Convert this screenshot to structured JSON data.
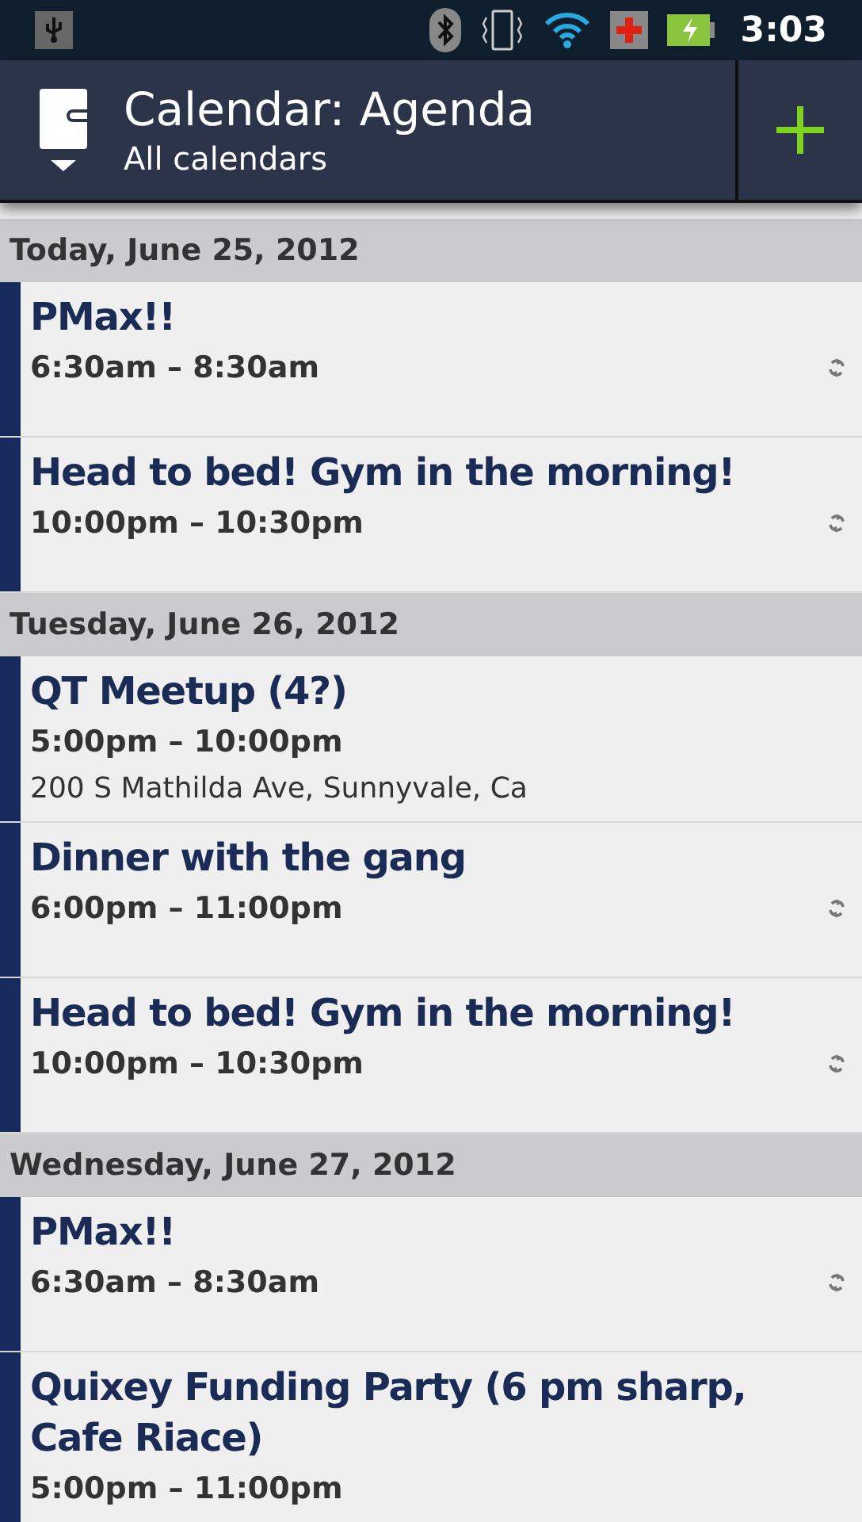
{
  "status_bar": {
    "time": "3:03"
  },
  "header": {
    "title": "Calendar: Agenda",
    "subtitle": "All calendars"
  },
  "sections": [
    {
      "date": "Today, June 25, 2012",
      "events": [
        {
          "title": "PMax!!",
          "time": "6:30am – 8:30am",
          "repeating": true,
          "color": "#172a5c"
        },
        {
          "title": "Head to bed! Gym in the morning!",
          "time": "10:00pm – 10:30pm",
          "repeating": true,
          "color": "#172a5c"
        }
      ]
    },
    {
      "date": "Tuesday, June 26, 2012",
      "events": [
        {
          "title": "QT Meetup (4?)",
          "time": "5:00pm – 10:00pm",
          "location": "200 S Mathilda Ave, Sunnyvale, Ca",
          "repeating": false,
          "color": "#172a5c"
        },
        {
          "title": "Dinner with the gang",
          "time": "6:00pm – 11:00pm",
          "repeating": true,
          "color": "#172a5c"
        },
        {
          "title": "Head to bed! Gym in the morning!",
          "time": "10:00pm – 10:30pm",
          "repeating": true,
          "color": "#172a5c"
        }
      ]
    },
    {
      "date": "Wednesday, June 27, 2012",
      "events": [
        {
          "title": "PMax!!",
          "time": "6:30am – 8:30am",
          "repeating": true,
          "color": "#172a5c"
        },
        {
          "title": "Quixey Funding Party (6 pm sharp, Cafe Riace)",
          "time": "5:00pm – 11:00pm",
          "repeating": false,
          "color": "#172a5c"
        }
      ]
    }
  ]
}
